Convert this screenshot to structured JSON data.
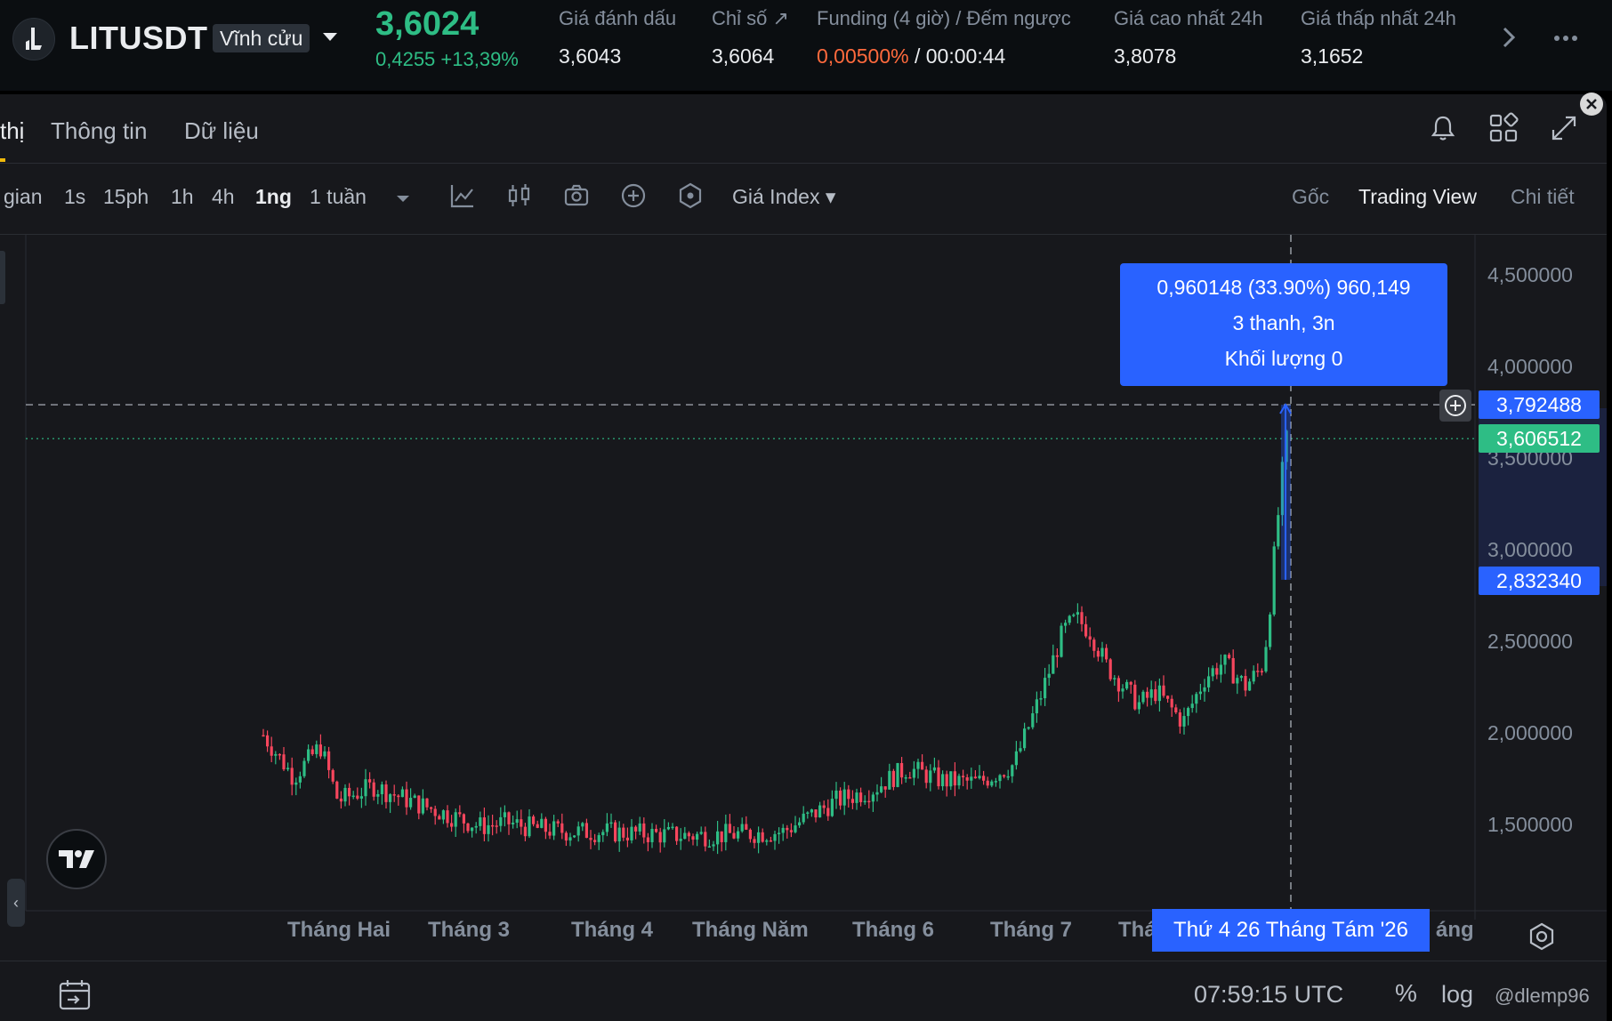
{
  "ticker": {
    "symbol": "LITUSDT",
    "contract_type": "Vĩnh cửu",
    "last_price": "3,6024",
    "change": "0,4255 +13,39%",
    "mark_price_label": "Giá đánh dấu",
    "mark_price": "3,6043",
    "index_label": "Chỉ số ↗",
    "index_price": "3,6064",
    "funding_label": "Funding (4 giờ) / Đếm ngược",
    "funding_rate": "0,00500%",
    "funding_sep": " / ",
    "countdown": "00:00:44",
    "high_label": "Giá cao nhất 24h",
    "high": "3,8078",
    "low_label": "Giá thấp nhất 24h",
    "low": "3,1652"
  },
  "tabs": {
    "market": "thị",
    "info": "Thông tin",
    "data": "Dữ liệu"
  },
  "toolbar": {
    "time_label": "gian",
    "timeframes": [
      "1s",
      "15ph",
      "1h",
      "4h",
      "1ng",
      "1 tuần"
    ],
    "active_timeframe": "1ng",
    "price_source": "Giá Index ▾",
    "views": [
      "Gốc",
      "Trading View",
      "Chi tiết"
    ],
    "active_view": "Trading View"
  },
  "chart": {
    "y_labels": [
      "4,500000",
      "4,000000",
      "3,500000",
      "3,000000",
      "2,500000",
      "2,000000",
      "1,500000"
    ],
    "x_labels": [
      "Tháng Hai",
      "Tháng 3",
      "Tháng 4",
      "Tháng Năm",
      "Tháng 6",
      "Tháng 7",
      "Thá",
      "áng"
    ],
    "measure": {
      "line1": "0,960148 (33.90%) 960,149",
      "line2": "3 thanh, 3n",
      "line3": "Khối lượng 0"
    },
    "tag_high": "3,792488",
    "tag_last": "3,606512",
    "tag_low": "2,832340",
    "cursor_date": "Thứ 4 26 Tháng Tám '26",
    "colors": {
      "up": "#2ebd85",
      "down": "#f6465d",
      "measure": "#2962ff"
    }
  },
  "bottom": {
    "utc_time": "07:59:15 UTC",
    "percent": "%",
    "log": "log",
    "watermark": "@dlemp96"
  }
}
